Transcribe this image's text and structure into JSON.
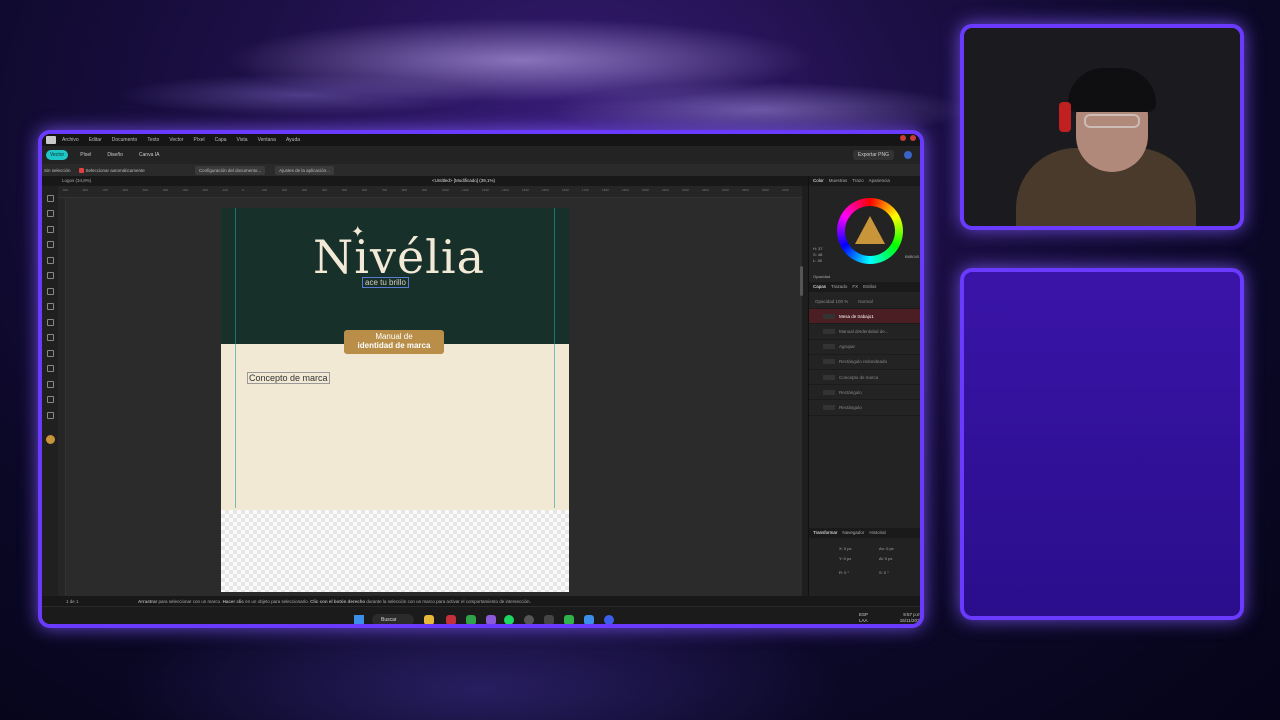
{
  "menu": [
    "Archivo",
    "Editar",
    "Documento",
    "Texto",
    "Vector",
    "Píxel",
    "Capa",
    "Vista",
    "Ventana",
    "Ayuda"
  ],
  "toolbar": {
    "personas": [
      "Vector",
      "Píxel",
      "Diseño",
      "Canva IA"
    ],
    "export_label": "Exportar PNG"
  },
  "context": {
    "selection": "Sin selección",
    "auto_select": "Seleccionar automáticamente",
    "doc_settings": "Configuración del documento...",
    "app_settings": "Ajustes de la aplicación..."
  },
  "tabs": {
    "left": "Logos (34,8%)",
    "main": "<Untitled> [Modificado] (39,1%)"
  },
  "ruler_labels": [
    "-900",
    "-800",
    "-700",
    "-600",
    "-500",
    "-400",
    "-300",
    "-200",
    "-100",
    "0",
    "100",
    "200",
    "300",
    "400",
    "500",
    "600",
    "700",
    "800",
    "900",
    "1000",
    "1100",
    "1200",
    "1300",
    "1400",
    "1500",
    "1600",
    "1700",
    "1800",
    "1900",
    "2000",
    "2100",
    "2200",
    "2300",
    "2400",
    "2500",
    "2600",
    "2700",
    "2800"
  ],
  "artboard": {
    "brand": "Nivélia",
    "tagline": "ace tu brillo",
    "badge_line1": "Manual de",
    "badge_line2": "identidad de marca",
    "concept": "Concepto de marca"
  },
  "color_panel": {
    "tabs": [
      "Color",
      "Muestras",
      "Trazo",
      "Apariencia"
    ],
    "hex": "B6B040",
    "h": "H: 37",
    "s": "S: 48",
    "l": "L: 45",
    "opacity_label": "Opacidad",
    "opacity_value": "100 %"
  },
  "layers_panel": {
    "tabs": [
      "Capas",
      "Trazado",
      "FX",
      "Estilos"
    ],
    "opacity": "Opacidad  100 %",
    "blend": "Normal",
    "items": [
      {
        "name": "Mesa de trabajo1",
        "selected": true
      },
      {
        "name": "Manual deIdentidad de...",
        "selected": false
      },
      {
        "name": "Agrupar",
        "selected": false
      },
      {
        "name": "Rectángulo redondeado",
        "selected": false
      },
      {
        "name": "Concepto de marca",
        "selected": false
      },
      {
        "name": "Rectángulo",
        "selected": false
      },
      {
        "name": "Rectángulo",
        "selected": false
      }
    ]
  },
  "transform_panel": {
    "tabs": [
      "Transformar",
      "Navegador",
      "Historial"
    ],
    "x": "X: 0 px",
    "y": "Y: 0 px",
    "w": "An: 0 px",
    "h": "Al: 0 px",
    "r": "R: 0 °",
    "s": "S: 0 °"
  },
  "status": {
    "page": "1 de 1",
    "hint_a": "Arrastrar",
    "hint_b": " para seleccionar con un marco. ",
    "hint_c": "Hacer clic",
    "hint_d": " en un objeto para seleccionarlo. ",
    "hint_e": "Clic con el botón derecho",
    "hint_f": " durante la selección con un marco para activar el comportamiento de intersección."
  },
  "taskbar": {
    "search": "Buscar",
    "lang1": "ESP",
    "lang2": "LAA",
    "time": "9:57 p.m.",
    "date": "15/11/2025"
  },
  "colors": {
    "accent_border": "#6a3bff",
    "persona_active": "#1fc6c6",
    "artboard_dark": "#17302a",
    "artboard_cream": "#f1e9d4",
    "badge_gold": "#b88e48",
    "layer_selected": "#4a1e22"
  }
}
